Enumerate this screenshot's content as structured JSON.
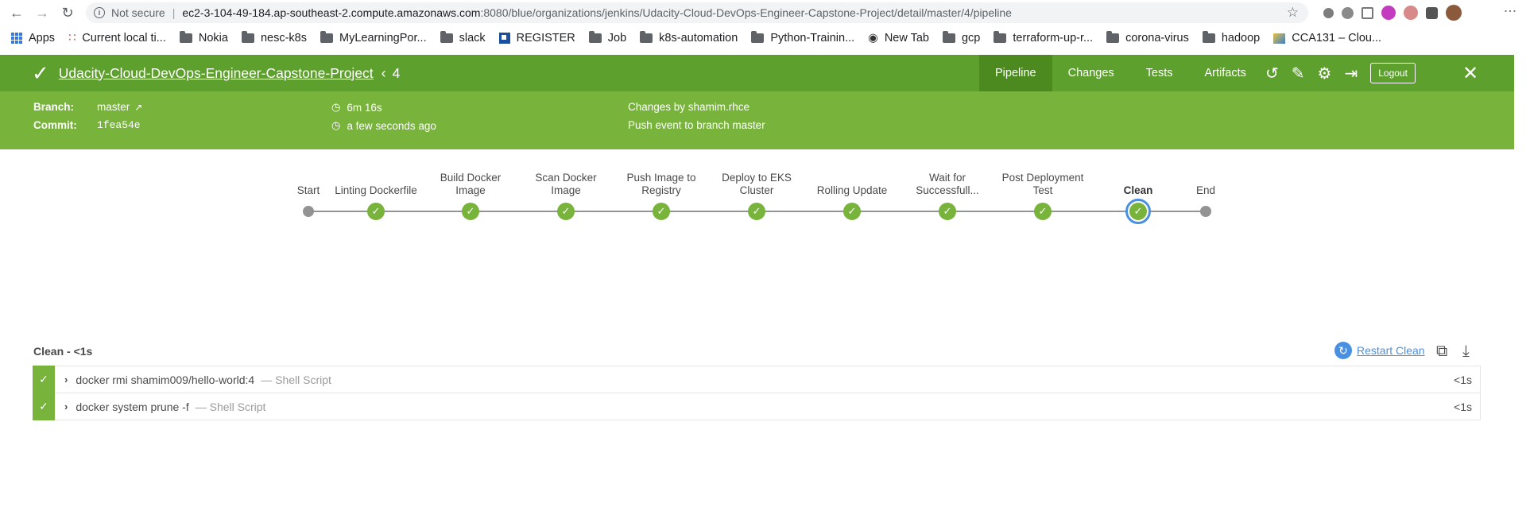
{
  "browser": {
    "security_label": "Not secure",
    "url_host": "ec2-3-104-49-184.ap-southeast-2.compute.amazonaws.com",
    "url_rest": ":8080/blue/organizations/jenkins/Udacity-Cloud-DevOps-Engineer-Capstone-Project/detail/master/4/pipeline"
  },
  "bookmarks": [
    {
      "label": "Apps",
      "icon": "apps-grid-icon"
    },
    {
      "label": "Current local ti...",
      "icon": "clock-dots-icon"
    },
    {
      "label": "Nokia",
      "icon": "folder-icon"
    },
    {
      "label": "nesc-k8s",
      "icon": "folder-icon"
    },
    {
      "label": "MyLearningPor...",
      "icon": "folder-icon"
    },
    {
      "label": "slack",
      "icon": "folder-icon"
    },
    {
      "label": "REGISTER",
      "icon": "register-icon"
    },
    {
      "label": "Job",
      "icon": "folder-icon"
    },
    {
      "label": "k8s-automation",
      "icon": "folder-icon"
    },
    {
      "label": "Python-Trainin...",
      "icon": "folder-icon"
    },
    {
      "label": "New Tab",
      "icon": "globe-icon"
    },
    {
      "label": "gcp",
      "icon": "folder-icon"
    },
    {
      "label": "terraform-up-r...",
      "icon": "folder-icon"
    },
    {
      "label": "corona-virus",
      "icon": "folder-icon"
    },
    {
      "label": "hadoop",
      "icon": "folder-icon"
    },
    {
      "label": "CCA131 – Clou...",
      "icon": "image-icon"
    }
  ],
  "header": {
    "project": "Udacity-Cloud-DevOps-Engineer-Capstone-Project",
    "run": "4",
    "tabs": [
      "Pipeline",
      "Changes",
      "Tests",
      "Artifacts"
    ],
    "active_tab": "Pipeline",
    "logout": "Logout",
    "accent_color": "#5ea02e"
  },
  "summary": {
    "branch_label": "Branch:",
    "branch": "master",
    "commit_label": "Commit:",
    "commit": "1fea54e",
    "duration": "6m 16s",
    "time": "a few seconds ago",
    "changes": "Changes by shamim.rhce",
    "cause": "Push event to branch master"
  },
  "pipeline": {
    "stages": [
      {
        "label": "Start",
        "kind": "start"
      },
      {
        "label": "Linting Dockerfile",
        "kind": "ok"
      },
      {
        "label": "Build Docker\nImage",
        "kind": "ok"
      },
      {
        "label": "Scan Docker\nImage",
        "kind": "ok"
      },
      {
        "label": "Push Image to\nRegistry",
        "kind": "ok"
      },
      {
        "label": "Deploy to EKS\nCluster",
        "kind": "ok"
      },
      {
        "label": "Rolling Update",
        "kind": "ok"
      },
      {
        "label": "Wait for\nSuccessfull...",
        "kind": "ok"
      },
      {
        "label": "Post Deployment\nTest",
        "kind": "ok"
      },
      {
        "label": "Clean",
        "kind": "selected"
      },
      {
        "label": "End",
        "kind": "end"
      }
    ]
  },
  "detail": {
    "title": "Clean - <1s",
    "restart_label": "Restart Clean",
    "steps": [
      {
        "name": "docker rmi shamim009/hello-world:4",
        "type": "— Shell Script",
        "duration": "<1s"
      },
      {
        "name": "docker system prune -f",
        "type": "— Shell Script",
        "duration": "<1s"
      }
    ]
  }
}
